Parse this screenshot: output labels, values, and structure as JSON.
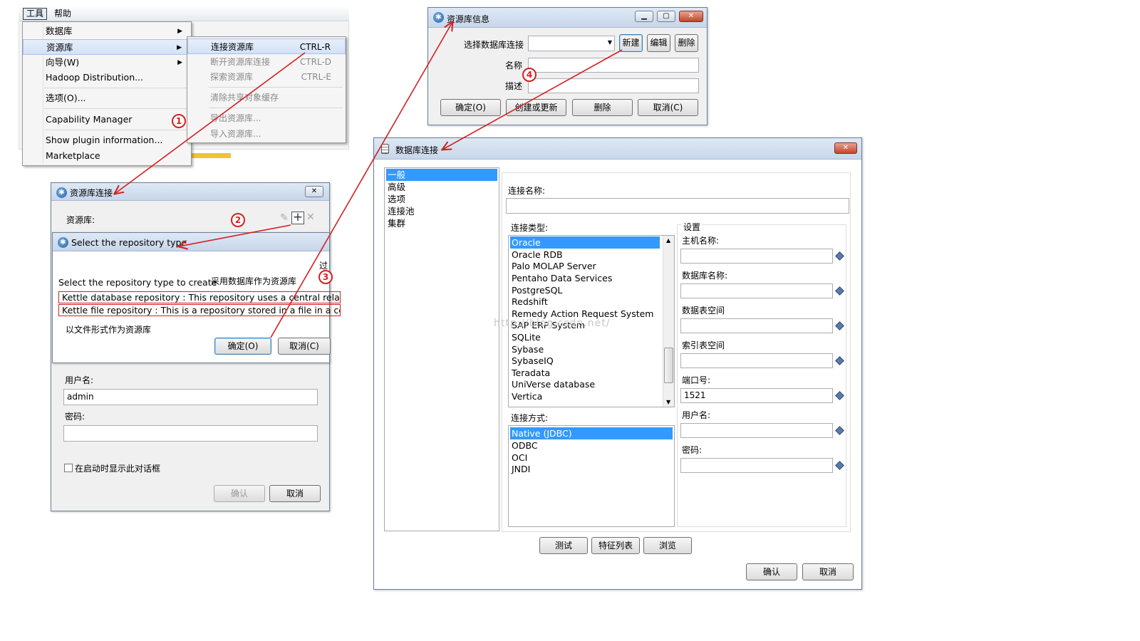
{
  "menubar": {
    "tools": "工具",
    "help": "帮助"
  },
  "tools_menu": {
    "items": [
      "数据库",
      "资源库",
      "向导(W)",
      "Hadoop Distribution...",
      "选项(O)...",
      "Capability Manager",
      "Show plugin information...",
      "Marketplace"
    ]
  },
  "repo_submenu": {
    "items": [
      {
        "label": "连接资源库",
        "shortcut": "CTRL-R"
      },
      {
        "label": "断开资源库连接",
        "shortcut": "CTRL-D"
      },
      {
        "label": "探索资源库",
        "shortcut": "CTRL-E"
      },
      {
        "label": "清除共享对象缓存",
        "shortcut": ""
      },
      {
        "label": "导出资源库...",
        "shortcut": ""
      },
      {
        "label": "导入资源库...",
        "shortcut": ""
      }
    ]
  },
  "markers": [
    "1",
    "2",
    "3",
    "4"
  ],
  "repo_login": {
    "title": "资源库连接",
    "repo_label": "资源库:",
    "username_label": "用户名:",
    "username_value": "admin",
    "password_label": "密码:",
    "show_at_startup": "在启动时显示此对话框",
    "ok": "确认",
    "cancel": "取消"
  },
  "select_repo_type": {
    "title": "Select the repository type",
    "prompt": "Select the repository type to create",
    "annotation_db": "采用数据库作为资源库",
    "annotation_file": "以文件形式作为资源库",
    "annotation_side": "过",
    "options": [
      "Kettle database repository : This repository uses a central relation",
      "Kettle file repository : This is a repository stored in a file in a certa"
    ],
    "ok": "确定(O)",
    "cancel": "取消(C)"
  },
  "repo_info": {
    "title": "资源库信息",
    "select_conn_label": "选择数据库连接",
    "new": "新建",
    "edit": "编辑",
    "delete_small": "删除",
    "name_label": "名称",
    "desc_label": "描述",
    "ok": "确定(O)",
    "create_update": "创建或更新",
    "delete": "删除",
    "cancel": "取消(C)"
  },
  "db_conn": {
    "title": "数据库连接",
    "close": "✕",
    "tabs": [
      "一般",
      "高级",
      "选项",
      "连接池",
      "集群"
    ],
    "conn_name_label": "连接名称:",
    "conn_type_label": "连接类型:",
    "conn_types": [
      "Oracle",
      "Oracle RDB",
      "Palo MOLAP Server",
      "Pentaho Data Services",
      "PostgreSQL",
      "Redshift",
      "Remedy Action Request System",
      "SAP ERP System",
      "SQLite",
      "Sybase",
      "SybaseIQ",
      "Teradata",
      "UniVerse database",
      "Vertica"
    ],
    "access_label": "连接方式:",
    "access_types": [
      "Native (JDBC)",
      "ODBC",
      "OCI",
      "JNDI"
    ],
    "settings_title": "设置",
    "settings": [
      {
        "label": "主机名称:",
        "value": ""
      },
      {
        "label": "数据库名称:",
        "value": ""
      },
      {
        "label": "数据表空间",
        "value": ""
      },
      {
        "label": "索引表空间",
        "value": ""
      },
      {
        "label": "端口号:",
        "value": "1521"
      },
      {
        "label": "用户名:",
        "value": ""
      },
      {
        "label": "密码:",
        "value": ""
      }
    ],
    "test": "测试",
    "features": "特征列表",
    "explore": "浏览",
    "ok": "确认",
    "cancel": "取消"
  },
  "watermark": "http://blog.csdn.net/",
  "colors": {
    "selection": "#3399ff",
    "annotation_red": "#d42020",
    "titlebar": "#c7d6ea"
  }
}
